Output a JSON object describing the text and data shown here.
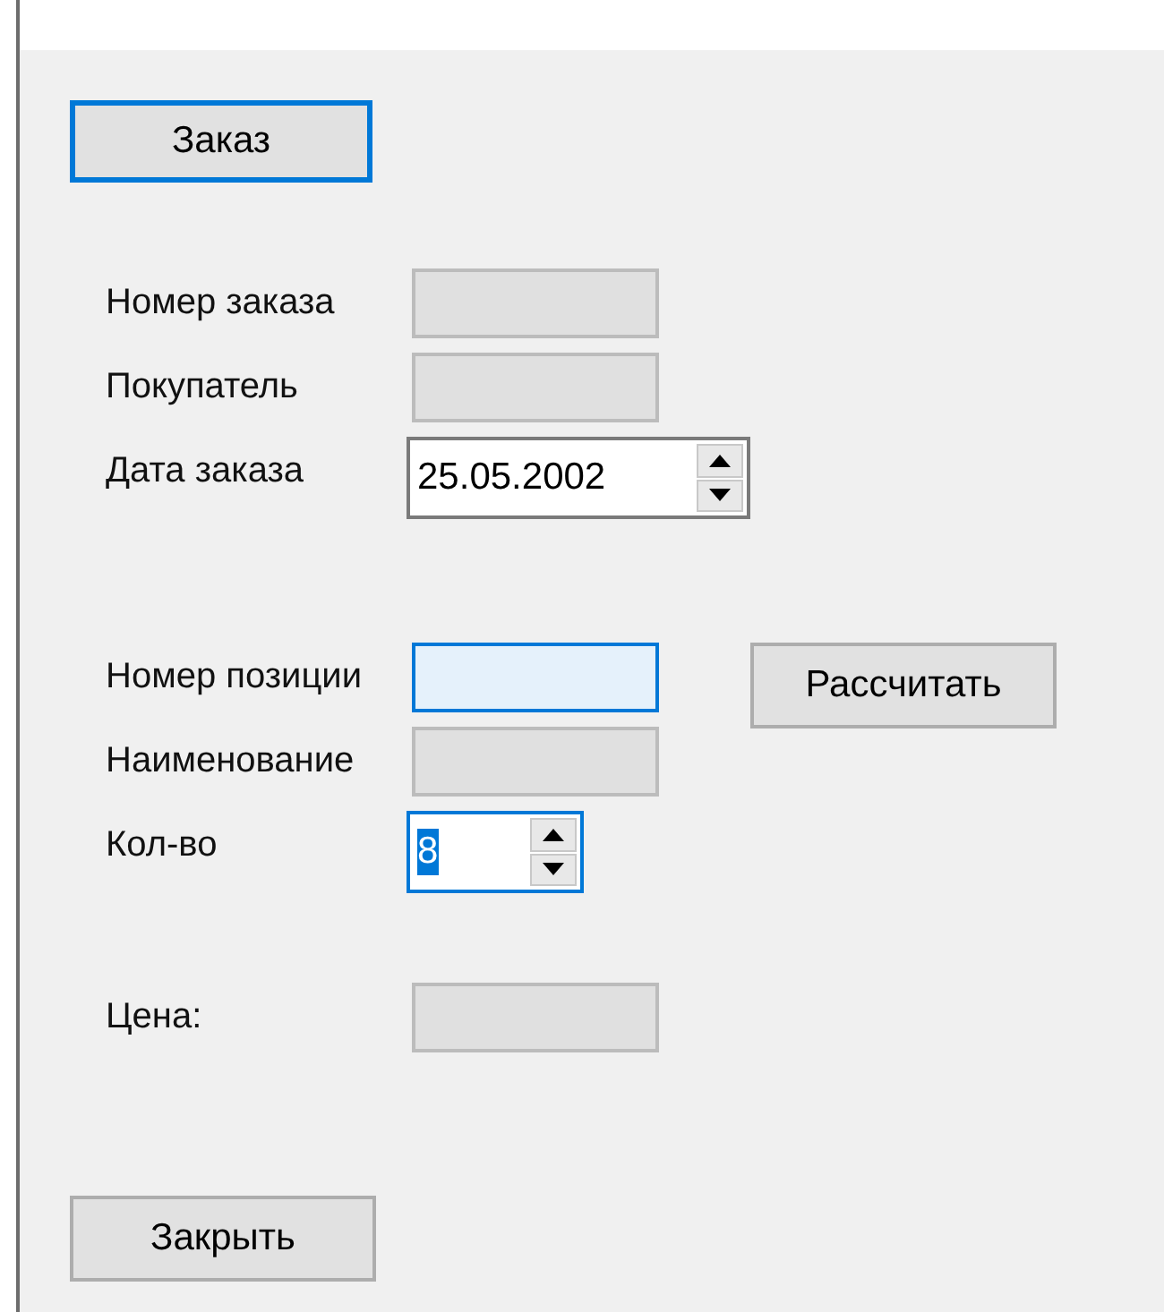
{
  "order_button": {
    "label": "Заказ",
    "focused": true
  },
  "order_fields": [
    {
      "label": "Номер заказа",
      "kind": "text",
      "disabled": true,
      "focused": false
    },
    {
      "label": "Покупатель",
      "kind": "text",
      "disabled": true,
      "focused": false
    },
    {
      "label": "Дата заказа",
      "kind": "spin",
      "value": "25.05.2002",
      "disabled": false,
      "focused": false,
      "value_selected": false
    }
  ],
  "item_fields": [
    {
      "label": "Номер позиции",
      "kind": "text",
      "disabled": false,
      "focused": true
    },
    {
      "label": "Наименование",
      "kind": "text",
      "disabled": true,
      "focused": false
    },
    {
      "label": "Кол-во",
      "kind": "spin",
      "value": "8",
      "disabled": false,
      "focused": true,
      "value_selected": true
    }
  ],
  "calculate_button": {
    "label": "Рассчитать",
    "focused": false
  },
  "price_field": {
    "label": "Цена:",
    "kind": "text",
    "disabled": true,
    "focused": false
  },
  "close_button": {
    "label": "Закрыть",
    "focused": false
  }
}
